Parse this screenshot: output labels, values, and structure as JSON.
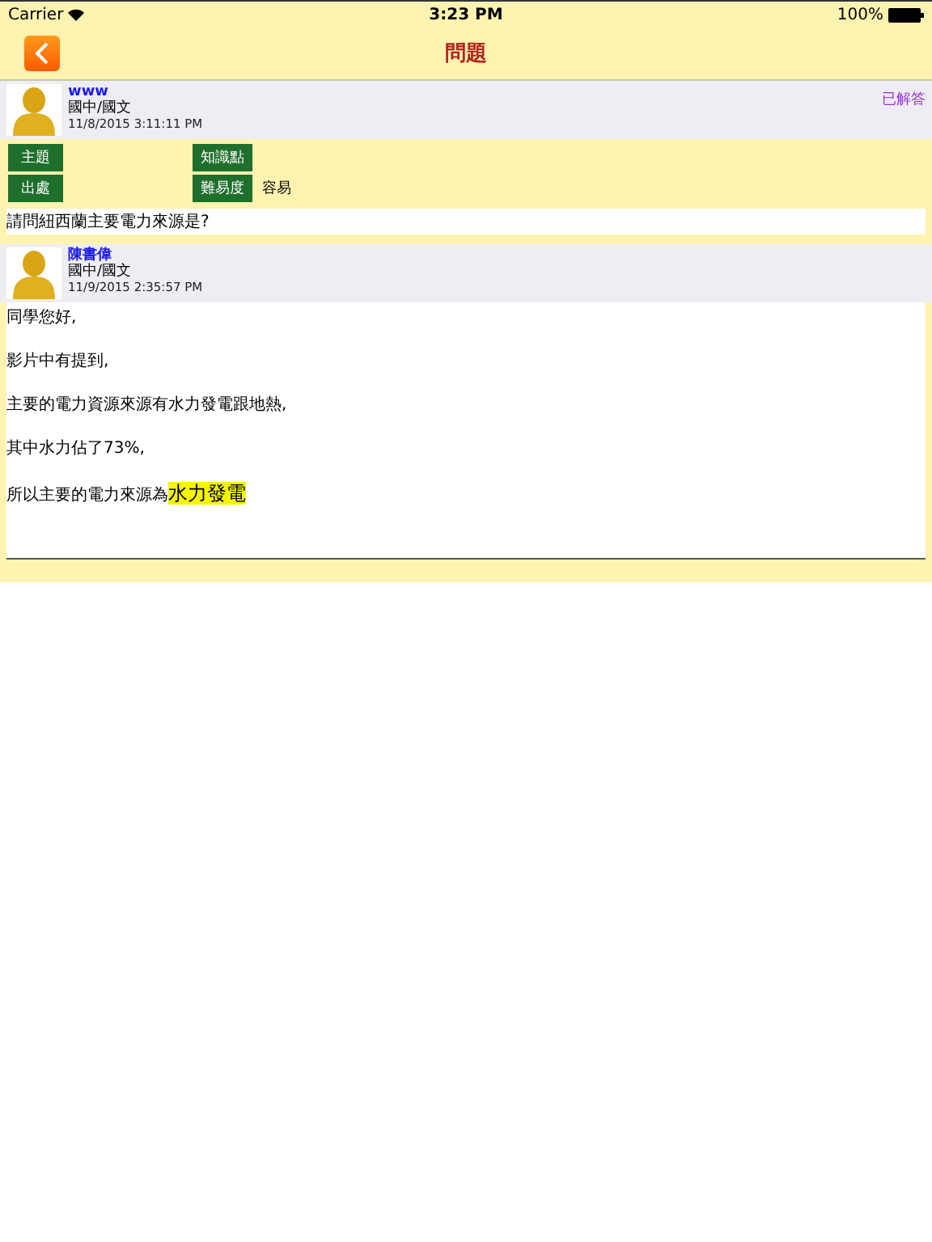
{
  "status_bar": {
    "carrier": "Carrier",
    "time": "3:23 PM",
    "battery": "100%"
  },
  "nav": {
    "title": "問題"
  },
  "question": {
    "author": "www",
    "subject": "國中/國文",
    "date": "11/8/2015 3:11:11 PM",
    "status": "已解答",
    "tags": [
      {
        "label": "主題"
      },
      {
        "label": "知識點"
      },
      {
        "label": "出處"
      },
      {
        "label": "難易度",
        "value": "容易"
      }
    ],
    "text": "請問紐西蘭主要電力來源是?"
  },
  "reply": {
    "author": "陳書偉",
    "subject": "國中/國文",
    "date": "11/9/2015 2:35:57 PM",
    "paragraphs": [
      {
        "text": "同學您好,"
      },
      {
        "text": "影片中有提到,"
      },
      {
        "text": "主要的電力資源來源有水力發電跟地熱,"
      },
      {
        "text": "其中水力佔了73%,"
      },
      {
        "text": "所以主要的電力來源為",
        "highlight": "水力發電"
      }
    ]
  }
}
